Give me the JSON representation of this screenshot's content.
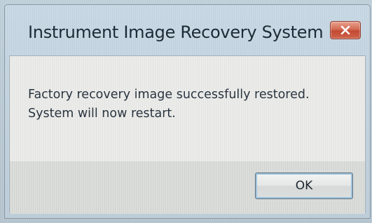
{
  "dialog": {
    "title": "Instrument Image Recovery System",
    "close_icon": "close-icon",
    "message_lines": [
      "Factory recovery image successfully restored.",
      "System will now restart."
    ],
    "ok_label": "OK"
  },
  "colors": {
    "close_button": "#d0634c",
    "frame": "#c3d3de",
    "client": "#ecedea"
  }
}
